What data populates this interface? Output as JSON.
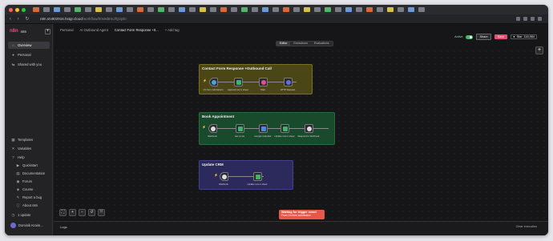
{
  "browser": {
    "url_host": "n8n.srv802916.hstgr.cloud",
    "url_path": "/workflow/h0x9d8mJfQ2pEI",
    "nav_icons": "‹ › ↻"
  },
  "sidebar": {
    "logo": "n8n",
    "brand": "n8n",
    "add_label": "+",
    "items": [
      {
        "label": "Overview",
        "icon": "home-icon",
        "glyph": "⌂"
      },
      {
        "label": "Personal",
        "icon": "user-icon",
        "glyph": "●"
      },
      {
        "label": "Shared with you",
        "icon": "share-icon",
        "glyph": "⇆"
      }
    ],
    "bottom_items": [
      {
        "label": "Templates",
        "glyph": "▦"
      },
      {
        "label": "Variables",
        "glyph": "✕"
      },
      {
        "label": "Help",
        "glyph": "?"
      },
      {
        "label": "Quickstart",
        "glyph": "▶"
      },
      {
        "label": "Documentation",
        "glyph": "▤"
      },
      {
        "label": "Forum",
        "glyph": "◉"
      },
      {
        "label": "Course",
        "glyph": "◈"
      },
      {
        "label": "Report a bug",
        "glyph": "✎"
      },
      {
        "label": "About n8n",
        "glyph": "ⓘ"
      },
      {
        "label": "1 update",
        "glyph": "◷"
      }
    ],
    "user_name": "Dominik Kraim..."
  },
  "header": {
    "breadcrumb": [
      "Personal",
      "AI Outbound Agent",
      "Contact Form Response +0...",
      "+ Add tag"
    ],
    "tabs": [
      "Editor",
      "Executions",
      "Evaluations"
    ],
    "active_label": "Active",
    "share_label": "Share",
    "save_label": "Save",
    "star_label": "Star",
    "star_count": "116,984",
    "plus_label": "+"
  },
  "canvas": {
    "stickies": [
      {
        "title": "Contact Form Response +Outbound Call",
        "color": "#4a4615"
      },
      {
        "title": "Book Appointment",
        "color": "#1a4a2c"
      },
      {
        "title": "Update CRM",
        "color": "#2c2a5c"
      }
    ],
    "nodes": [
      {
        "label": "On form submission",
        "color": "#4aa3d8"
      },
      {
        "label": "Append row in sheet",
        "color": "#3cb56b"
      },
      {
        "label": "Wait",
        "color": "#e0508a"
      },
      {
        "label": "HTTP Request",
        "color": "#6a6ad8"
      },
      {
        "label": "Webhook",
        "color": "#dddddd"
      },
      {
        "label": "Get a row",
        "color": "#3cb56b"
      },
      {
        "label": "Google Calendar",
        "color": "#4a8ae0"
      },
      {
        "label": "Update row in sheet",
        "color": "#3cb56b"
      },
      {
        "label": "Respond to Webhook",
        "color": "#dddddd"
      },
      {
        "label": "Webhook",
        "color": "#dddddd"
      },
      {
        "label": "Update row in sheet",
        "color": "#3cb56b"
      }
    ]
  },
  "bottom": {
    "zoom_buttons": [
      "⛶",
      "+",
      "−",
      "↺",
      "⤧"
    ],
    "logs_label": "Logs",
    "clear_label": "Clear execution"
  },
  "toast": {
    "title": "Waiting for trigger event",
    "subtitle": "From On form submission"
  }
}
